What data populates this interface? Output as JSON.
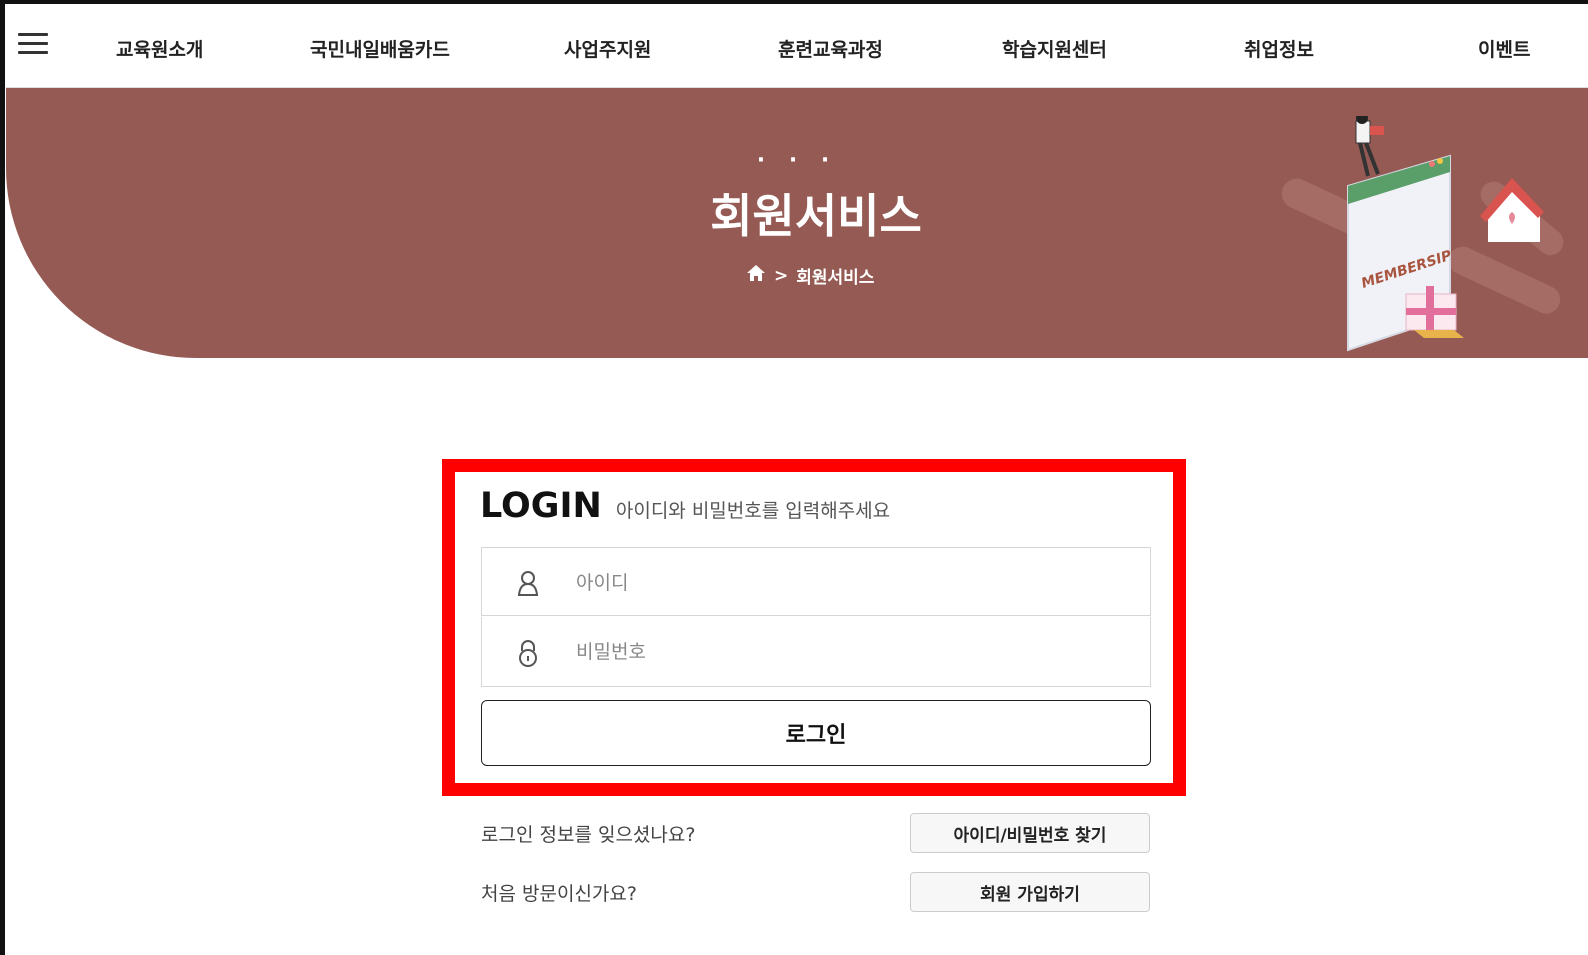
{
  "nav": {
    "items": [
      "교육원소개",
      "국민내일배움카드",
      "사업주지원",
      "훈련교육과정",
      "학습지원센터",
      "취업정보",
      "이벤트"
    ]
  },
  "banner": {
    "dots": "· · ·",
    "title": "회원서비스",
    "breadcrumb_separator": ">",
    "breadcrumb_current": "회원서비스",
    "illustration_text": "MEMBERSIP",
    "color": "#955a53"
  },
  "login": {
    "heading": "LOGIN",
    "subheading": "아이디와 비밀번호를 입력해주세요",
    "id_placeholder": "아이디",
    "id_value": "",
    "pw_placeholder": "비밀번호",
    "pw_value": "",
    "button_label": "로그인",
    "highlight_color": "#ff0000"
  },
  "help": {
    "forgot_text": "로그인 정보를 잊으셨나요?",
    "forgot_button": "아이디/비밀번호 찾기",
    "first_visit_text": "처음 방문이신가요?",
    "signup_button": "회원 가입하기"
  },
  "icons": {
    "menu": "hamburger-icon",
    "home": "home-icon",
    "user": "user-icon",
    "lock": "lock-icon"
  }
}
